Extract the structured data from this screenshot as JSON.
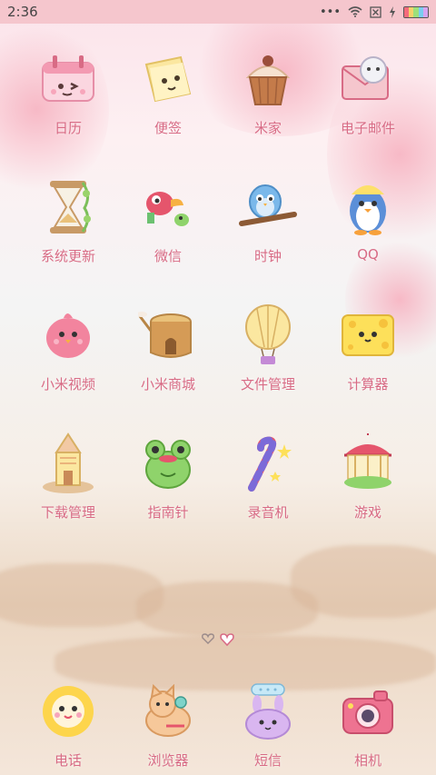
{
  "status_bar": {
    "time": "2:36",
    "dots": "•••",
    "wifi_icon": "wifi-icon",
    "sim_icon": "sim-icon",
    "battery_icon": "battery-icon"
  },
  "apps": [
    {
      "label": "日历",
      "icon": "calendar-icon"
    },
    {
      "label": "便签",
      "icon": "notes-icon"
    },
    {
      "label": "米家",
      "icon": "cupcake-icon"
    },
    {
      "label": "电子邮件",
      "icon": "mail-icon"
    },
    {
      "label": "系统更新",
      "icon": "hourglass-icon"
    },
    {
      "label": "微信",
      "icon": "bird-icon"
    },
    {
      "label": "时钟",
      "icon": "bluebird-icon"
    },
    {
      "label": "QQ",
      "icon": "penguin-icon"
    },
    {
      "label": "小米视频",
      "icon": "pink-bird-icon"
    },
    {
      "label": "小米商城",
      "icon": "tree-stump-icon"
    },
    {
      "label": "文件管理",
      "icon": "balloon-icon"
    },
    {
      "label": "计算器",
      "icon": "cheese-icon"
    },
    {
      "label": "下载管理",
      "icon": "pencil-house-icon"
    },
    {
      "label": "指南针",
      "icon": "frog-icon"
    },
    {
      "label": "录音机",
      "icon": "candy-cane-icon"
    },
    {
      "label": "游戏",
      "icon": "carousel-icon"
    }
  ],
  "dock": [
    {
      "label": "电话",
      "icon": "sun-icon"
    },
    {
      "label": "浏览器",
      "icon": "cat-icon"
    },
    {
      "label": "短信",
      "icon": "bunny-icon"
    },
    {
      "label": "相机",
      "icon": "camera-icon"
    }
  ],
  "colors": {
    "label": "#d86b85",
    "status_bar": "#f5c6cd"
  }
}
